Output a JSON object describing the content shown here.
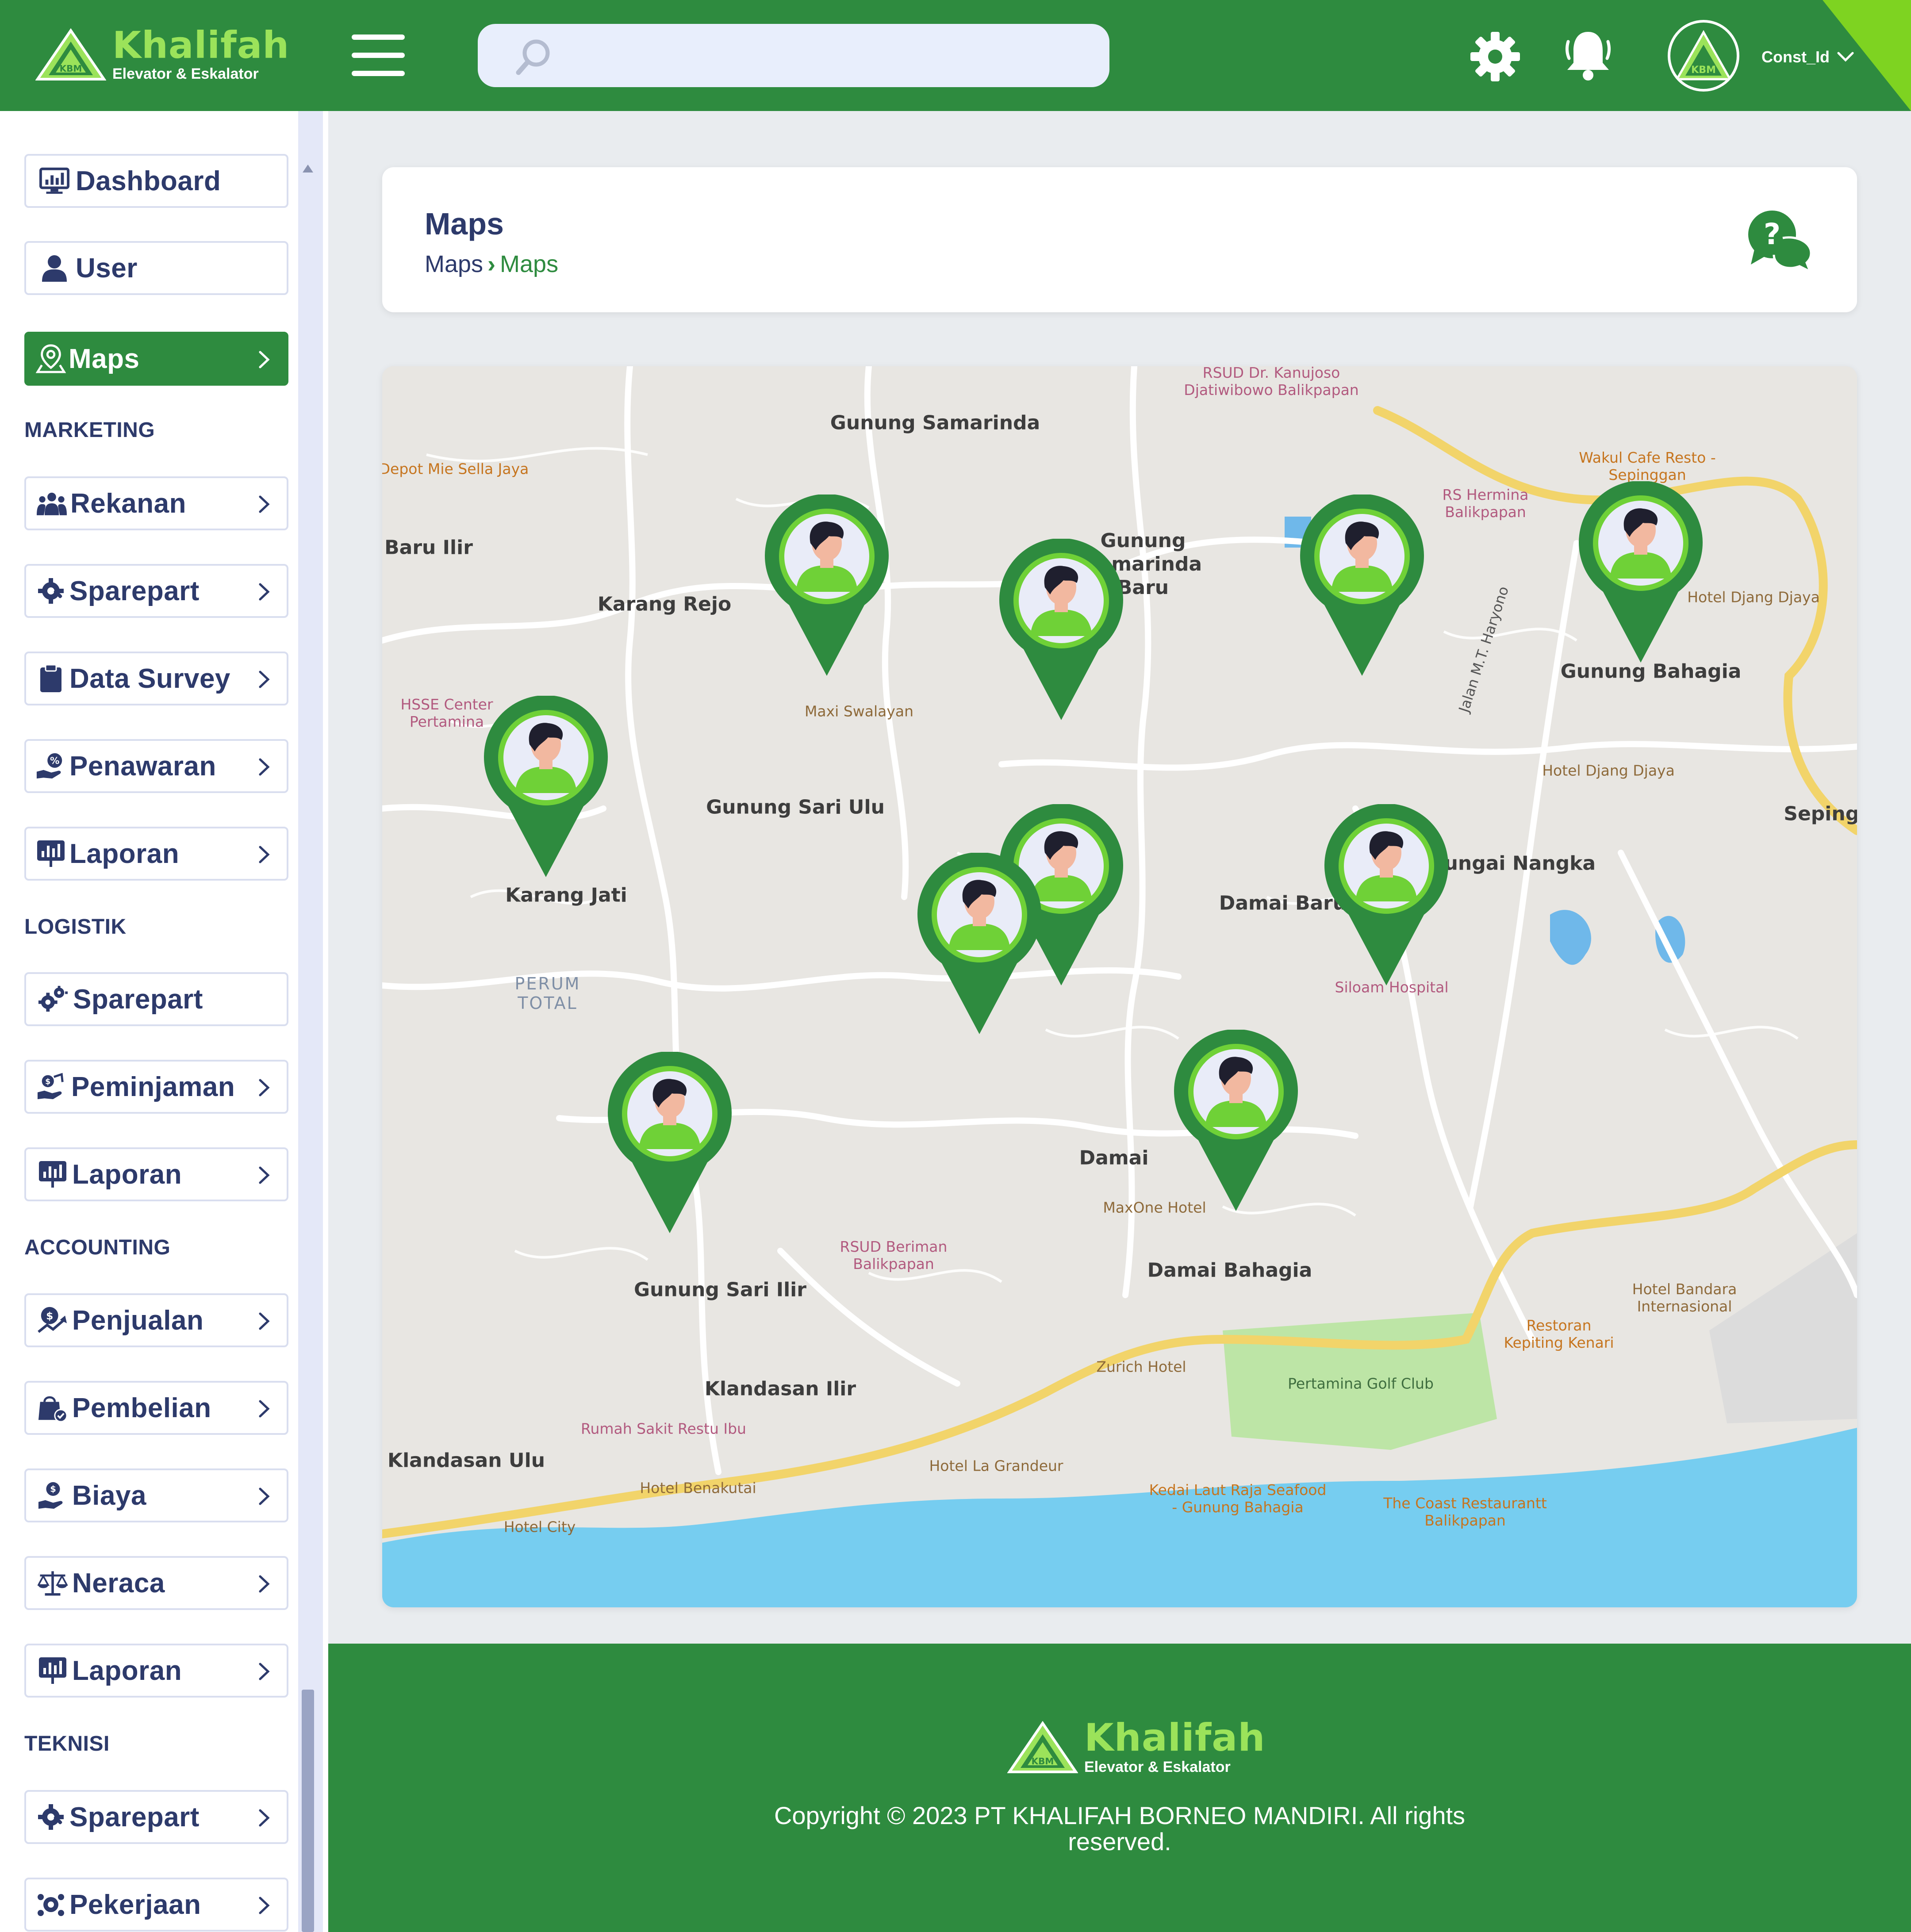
{
  "brand": {
    "name": "Khalifah",
    "tagline": "Elevator & Eskalator",
    "logo_text": "KBM"
  },
  "header": {
    "search": {
      "placeholder": "",
      "value": ""
    },
    "user_name": "Const_Id",
    "icons": [
      "menu-icon",
      "search-icon",
      "gear-icon",
      "bell-icon",
      "chevron-down-icon"
    ]
  },
  "sidebar": {
    "items": [
      {
        "label": "Dashboard",
        "icon": "dashboard-icon"
      },
      {
        "label": "User",
        "icon": "user-icon"
      },
      {
        "label": "Maps",
        "icon": "map-pin-icon",
        "active": true
      }
    ],
    "sections": [
      {
        "title": "MARKETING",
        "items": [
          {
            "label": "Rekanan",
            "icon": "users-icon"
          },
          {
            "label": "Sparepart",
            "icon": "wrench-icon"
          },
          {
            "label": "Data Survey",
            "icon": "clipboard-icon"
          },
          {
            "label": "Penawaran",
            "icon": "discount-hand-icon"
          },
          {
            "label": "Laporan",
            "icon": "report-icon"
          }
        ]
      },
      {
        "title": "LOGISTIK",
        "items": [
          {
            "label": "Sparepart",
            "icon": "gears-icon"
          },
          {
            "label": "Peminjaman",
            "icon": "coins-hand-icon"
          },
          {
            "label": "Laporan",
            "icon": "report-icon"
          }
        ]
      },
      {
        "title": "ACCOUNTING",
        "items": [
          {
            "label": "Penjualan",
            "icon": "sales-icon"
          },
          {
            "label": "Pembelian",
            "icon": "shopping-bag-icon"
          },
          {
            "label": "Biaya",
            "icon": "money-hand-icon"
          },
          {
            "label": "Neraca",
            "icon": "scale-icon"
          },
          {
            "label": "Laporan",
            "icon": "report-icon"
          }
        ]
      },
      {
        "title": "TEKNISI",
        "items": [
          {
            "label": "Sparepart",
            "icon": "wrench-icon"
          },
          {
            "label": "Pekerjaan",
            "icon": "team-icon"
          }
        ]
      }
    ]
  },
  "page": {
    "title": "Maps",
    "breadcrumb": [
      "Maps",
      "Maps"
    ]
  },
  "map": {
    "places": [
      "Gunung Samarinda",
      "Baru Ilir",
      "Karang Rejo",
      "Gunung Sari Ulu",
      "Karang Jati",
      "Gunung Samarinda Baru",
      "Gunung Bahagia",
      "Sungai Nangka",
      "Damai Baru",
      "Damai",
      "Damai Bahagia",
      "Gunung Sari Ilir",
      "Klandasan Ilir",
      "Klandasan Ulu",
      "Sepinggan"
    ],
    "pois": [
      "Depot Mie Sella Jaya",
      "RSUD Dr. Kanujoso Djatiwibowo Balikpapan",
      "RS Hermina Balikpapan",
      "Wakul Cafe Resto - Sepinggan",
      "Hotel Djang Djaya",
      "HSSE Center Pertamina",
      "Maxi Swalayan",
      "Siloam Hospital",
      "MaxOne Hotel",
      "RSUD Beriman Balikpapan",
      "Rumah Sakit Restu Ibu",
      "Hotel Benakutai",
      "Hotel City",
      "Zurich Hotel",
      "Hotel La Grandeur",
      "Pertamina Golf Club",
      "Kedai Laut Raja Seafood - Gunung Bahagia",
      "The Coast Restaurantt Balikpapan",
      "Restoran Kepiting Kenari",
      "Hotel Bandara Internasional",
      "Jalan M.T. Haryono",
      "PERUM TOTAL"
    ],
    "marker_count": 10,
    "colors": {
      "marker": "#2e8b3f",
      "marker_ring": "#6fd137",
      "sea": "#76cdf0",
      "road_major": "#f2d46a"
    }
  },
  "footer": {
    "copyright": [
      "Copyright © 2023 PT KHALIFAH BORNEO MANDIRI. All rights",
      "reserved."
    ]
  },
  "colors": {
    "primary": "#2e8b3f",
    "accent": "#7ed321",
    "text": "#2d3a6b",
    "background": "#e9ecef"
  }
}
